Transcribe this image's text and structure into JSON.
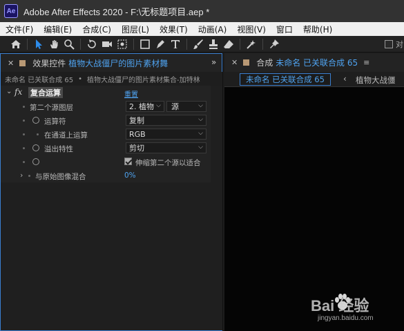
{
  "window": {
    "app_icon": "Ae",
    "title": "Adobe After Effects 2020 - F:\\无标题项目.aep *"
  },
  "menu": [
    "文件(F)",
    "编辑(E)",
    "合成(C)",
    "图层(L)",
    "效果(T)",
    "动画(A)",
    "视图(V)",
    "窗口",
    "帮助(H)"
  ],
  "toolbar": {
    "tools": [
      "home-icon",
      "selection-tool-icon",
      "hand-tool-icon",
      "zoom-tool-icon",
      "rotate-tool-icon",
      "camera-tool-icon",
      "pan-behind-tool-icon",
      "rectangle-tool-icon",
      "pen-tool-icon",
      "type-tool-icon",
      "brush-tool-icon",
      "clone-stamp-tool-icon",
      "eraser-tool-icon",
      "roto-brush-tool-icon",
      "puppet-pin-tool-icon"
    ],
    "align_label": "对"
  },
  "effect_controls": {
    "tab_label": "效果控件",
    "tab_layer": "植物大战僵尸的图片素材舞",
    "breadcrumb_comp": "未命名 已关联合成 65",
    "breadcrumb_sep": "•",
    "breadcrumb_layer": "植物大战僵尸的图片素材集合-加特林",
    "effect": {
      "name": "复合运算",
      "reset": "重置",
      "properties": [
        {
          "label": "第二个源图层",
          "value": "2. 植物",
          "value2": "源"
        },
        {
          "label": "运算符",
          "value": "复制"
        },
        {
          "label": "在通道上运算",
          "value": "RGB"
        },
        {
          "label": "溢出特性",
          "value": "剪切"
        },
        {
          "label": "",
          "checkbox_label": "伸缩第二个源以适合",
          "checked": true
        },
        {
          "label": "与原始图像混合",
          "value": "0%"
        }
      ]
    }
  },
  "composition": {
    "tab_label": "合成",
    "tab_name": "未命名 已关联合成 65",
    "active_subtab": "未命名 已关联合成 65",
    "other_subtab": "植物大战僵"
  },
  "watermark": {
    "brand": "Bai  经验",
    "url": "jingyan.baidu.com"
  }
}
